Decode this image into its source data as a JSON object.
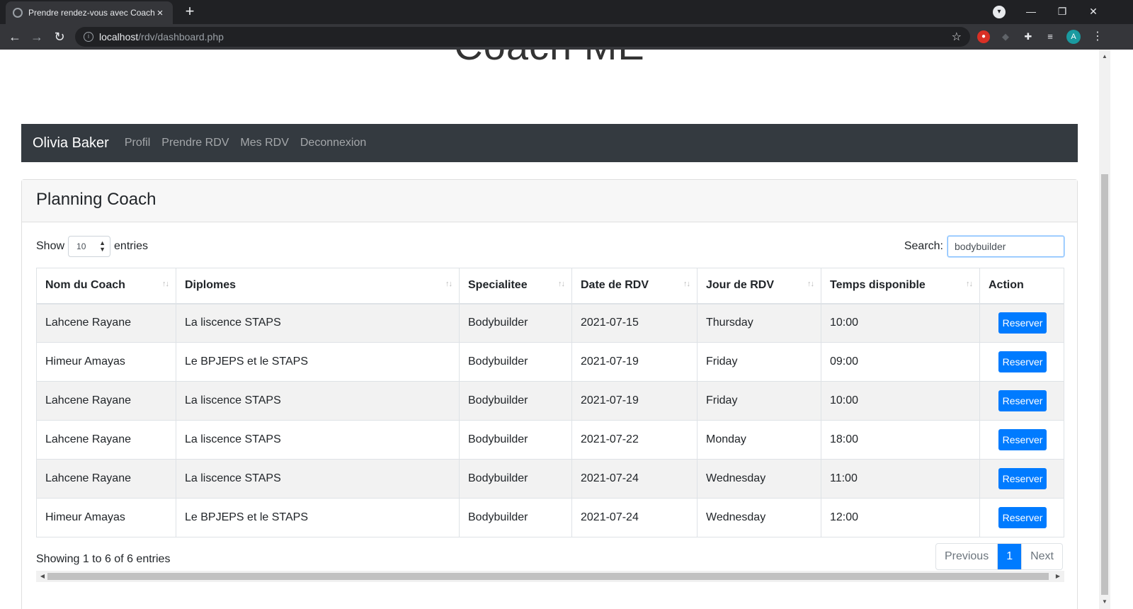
{
  "browser": {
    "tab_title": "Prendre rendez-vous avec Coach",
    "tab_close": "×",
    "new_tab": "+",
    "url_host": "localhost",
    "url_path": "/rdv/dashboard.php",
    "avatar_letter": "A",
    "icons": {
      "back": "←",
      "forward": "→",
      "reload": "↻",
      "info": "i",
      "star": "☆",
      "minimize": "—",
      "restore": "❐",
      "close": "✕",
      "kebab": "⋮",
      "profile_menu": "▾"
    }
  },
  "page": {
    "heading": "Coach ME",
    "navbar": {
      "brand": "Olivia Baker",
      "links": [
        "Profil",
        "Prendre RDV",
        "Mes RDV",
        "Deconnexion"
      ]
    },
    "card_title": "Planning Coach",
    "length": {
      "prefix": "Show",
      "value": "10",
      "suffix": "entries"
    },
    "search": {
      "label": "Search:",
      "value": "bodybuilder"
    },
    "table": {
      "columns": [
        "Nom du Coach",
        "Diplomes",
        "Specialitee",
        "Date de RDV",
        "Jour de RDV",
        "Temps disponible",
        "Action"
      ],
      "rows": [
        {
          "coach": "Lahcene Rayane",
          "diplome": "La liscence STAPS",
          "specialite": "Bodybuilder",
          "date": "2021-07-15",
          "jour": "Thursday",
          "temps": "10:00",
          "action": "Reserver"
        },
        {
          "coach": "Himeur Amayas",
          "diplome": "Le BPJEPS et le STAPS",
          "specialite": "Bodybuilder",
          "date": "2021-07-19",
          "jour": "Friday",
          "temps": "09:00",
          "action": "Reserver"
        },
        {
          "coach": "Lahcene Rayane",
          "diplome": "La liscence STAPS",
          "specialite": "Bodybuilder",
          "date": "2021-07-19",
          "jour": "Friday",
          "temps": "10:00",
          "action": "Reserver"
        },
        {
          "coach": "Lahcene Rayane",
          "diplome": "La liscence STAPS",
          "specialite": "Bodybuilder",
          "date": "2021-07-22",
          "jour": "Monday",
          "temps": "18:00",
          "action": "Reserver"
        },
        {
          "coach": "Lahcene Rayane",
          "diplome": "La liscence STAPS",
          "specialite": "Bodybuilder",
          "date": "2021-07-24",
          "jour": "Wednesday",
          "temps": "11:00",
          "action": "Reserver"
        },
        {
          "coach": "Himeur Amayas",
          "diplome": "Le BPJEPS et le STAPS",
          "specialite": "Bodybuilder",
          "date": "2021-07-24",
          "jour": "Wednesday",
          "temps": "12:00",
          "action": "Reserver"
        }
      ]
    },
    "info": "Showing 1 to 6 of 6 entries",
    "pagination": {
      "previous": "Previous",
      "current": "1",
      "next": "Next"
    }
  },
  "colors": {
    "navbar_bg": "#343a40",
    "primary": "#007bff",
    "stripe": "#f2f2f2"
  }
}
